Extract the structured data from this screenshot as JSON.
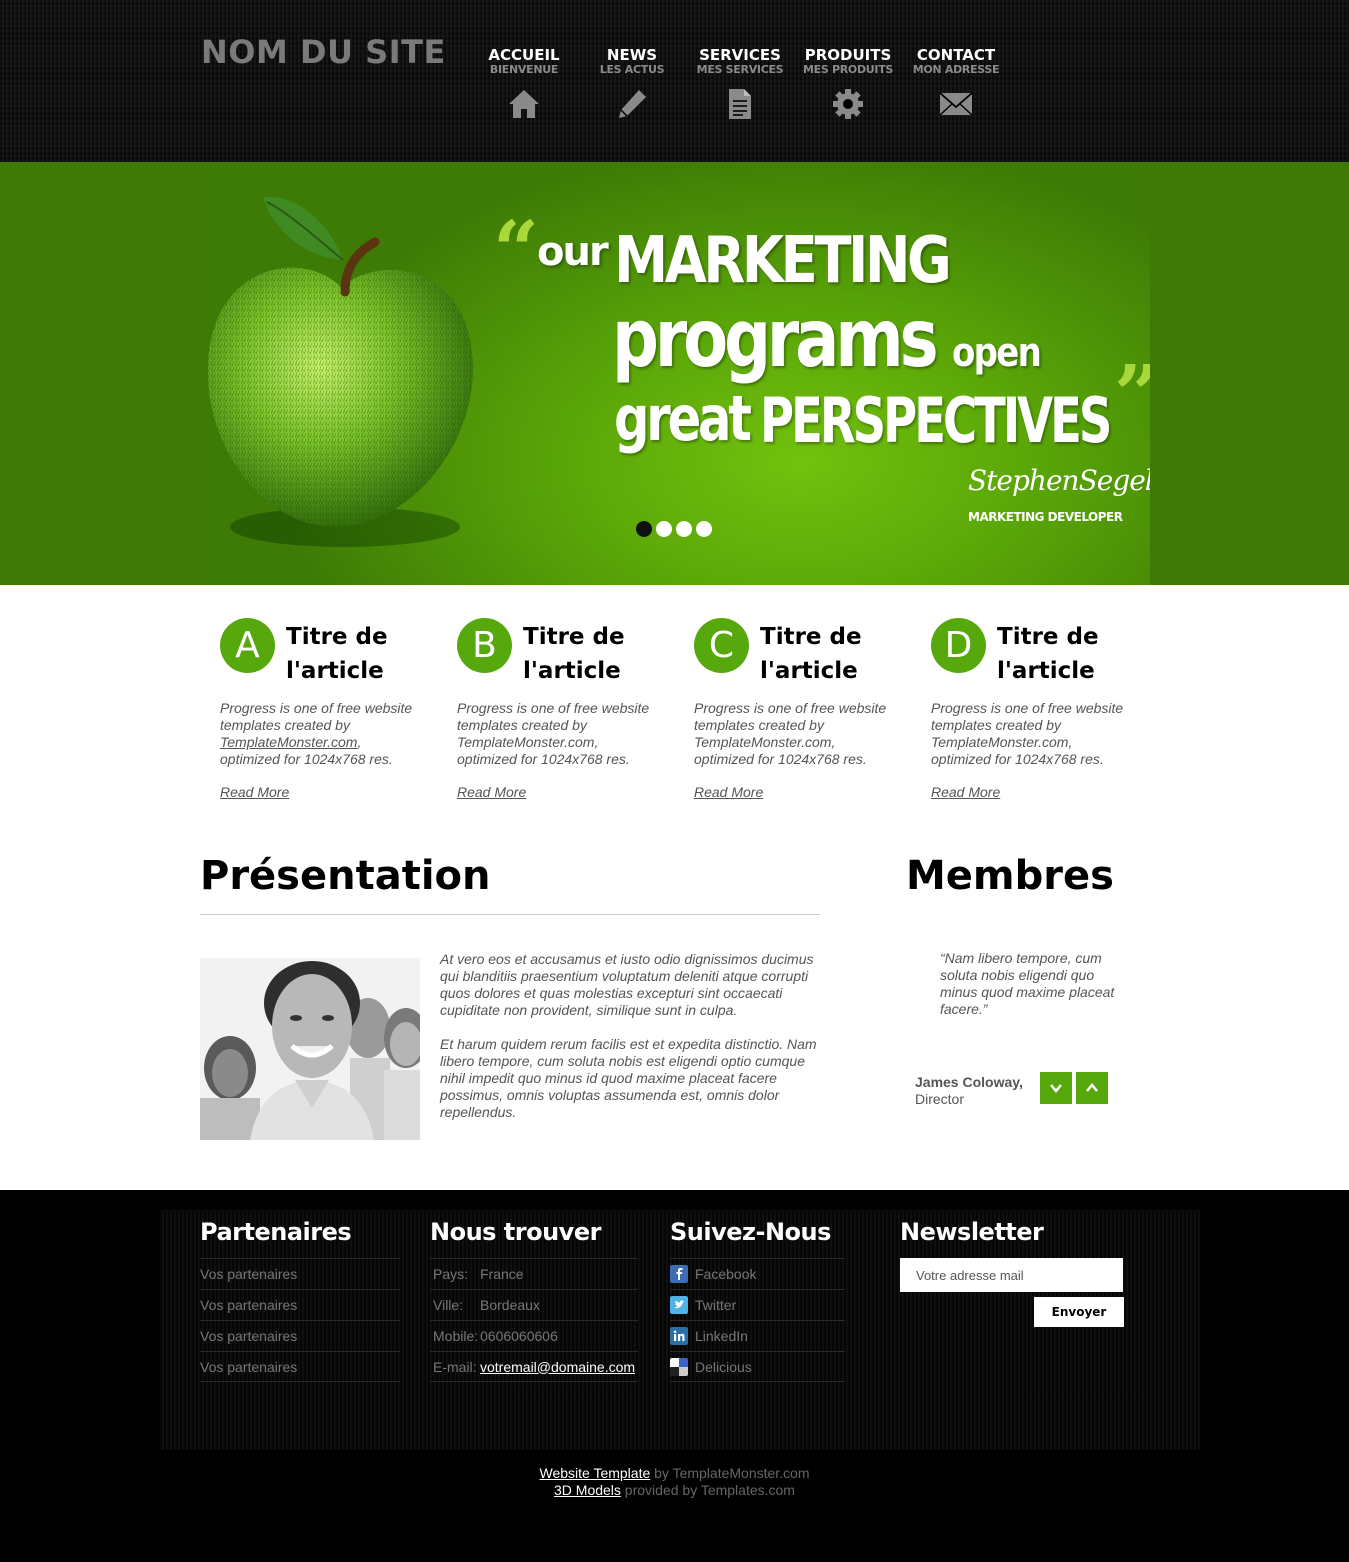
{
  "header": {
    "site_name": "NOM DU SITE",
    "nav": [
      {
        "label": "ACCUEIL",
        "sub": "BIENVENUE",
        "icon": "home-icon"
      },
      {
        "label": "NEWS",
        "sub": "LES ACTUS",
        "icon": "pencil-icon"
      },
      {
        "label": "SERVICES",
        "sub": "MES SERVICES",
        "icon": "document-icon"
      },
      {
        "label": "PRODUITS",
        "sub": "MES PRODUITS",
        "icon": "gear-icon"
      },
      {
        "label": "CONTACT",
        "sub": "MON ADRESSE",
        "icon": "envelope-icon"
      }
    ]
  },
  "hero": {
    "quote_open": "“",
    "quote_close": "”",
    "line_our": "our",
    "line_marketing": "MARKETING",
    "line_programs": "programs",
    "line_open": "open",
    "line_great": "great",
    "line_perspectives": "PERSPECTIVES",
    "signature": "StephenSegel",
    "role": "MARKETING DEVELOPER",
    "slides_total": 4,
    "active_slide": 1
  },
  "articles": [
    {
      "letter": "A",
      "title": "Titre de l'article",
      "text_a": "Progress is one of free website templates created by ",
      "text_link": "TemplateMonster.com",
      "text_b": ", optimized for 1024x768 res.",
      "read_more": "Read More"
    },
    {
      "letter": "B",
      "title": "Titre de l'article",
      "text_a": "Progress is one of free website templates created by ",
      "text_link": "TemplateMonster.com",
      "text_b": ", optimized for 1024x768 res.",
      "read_more": "Read More"
    },
    {
      "letter": "C",
      "title": "Titre de l'article",
      "text_a": "Progress is one of free website templates created by ",
      "text_link": "TemplateMonster.com",
      "text_b": ", optimized for 1024x768 res.",
      "read_more": "Read More"
    },
    {
      "letter": "D",
      "title": "Titre de l'article",
      "text_a": "Progress is one of free website templates created by ",
      "text_link": "TemplateMonster.com",
      "text_b": ", optimized for 1024x768 res.",
      "read_more": "Read More"
    }
  ],
  "presentation": {
    "title": "Présentation",
    "p1": "At vero eos et accusamus et iusto odio dignissimos ducimus qui blanditiis praesentium voluptatum deleniti atque corrupti quos dolores et quas molestias excepturi sint occaecati cupiditate non provident, similique sunt in culpa.",
    "p2": "Et harum quidem rerum facilis est et expedita distinctio. Nam libero tempore, cum soluta nobis est eligendi optio cumque nihil impedit quo minus id quod maxime placeat facere possimus, omnis voluptas assumenda est, omnis dolor repellendus."
  },
  "members": {
    "title": "Membres",
    "quote": "“Nam libero tempore, cum soluta nobis eligendi quo minus quod maxime placeat facere.”",
    "name": "James Coloway,",
    "role": "Director"
  },
  "footer": {
    "partners": {
      "title": "Partenaires",
      "items": [
        "Vos partenaires",
        "Vos partenaires",
        "Vos partenaires",
        "Vos partenaires"
      ]
    },
    "find_us": {
      "title": "Nous trouver",
      "rows": [
        {
          "key": "Pays:",
          "value": "France"
        },
        {
          "key": "Ville:",
          "value": "Bordeaux"
        },
        {
          "key": "Mobile:",
          "value": "0606060606"
        },
        {
          "key": "E-mail:",
          "value": "votremail@domaine.com"
        }
      ]
    },
    "follow": {
      "title": "Suivez-Nous",
      "items": [
        {
          "label": "Facebook",
          "icon": "facebook-icon",
          "color": "#3b6cb4"
        },
        {
          "label": "Twitter",
          "icon": "twitter-icon",
          "color": "#4fb3e8"
        },
        {
          "label": "LinkedIn",
          "icon": "linkedin-icon",
          "color": "#2a6ea6"
        },
        {
          "label": "Delicious",
          "icon": "delicious-icon",
          "color": "#3a62c8"
        }
      ]
    },
    "newsletter": {
      "title": "Newsletter",
      "placeholder": "Votre adresse mail",
      "button": "Envoyer"
    },
    "credits": {
      "link1": "Website Template",
      "text1": " by TemplateMonster.com",
      "link2": "3D Models",
      "text2": " provided by Templates.com"
    }
  },
  "colors": {
    "accent": "#56a80c",
    "hero_green": "#5aa608",
    "header_bg": "#0d0d0d"
  }
}
